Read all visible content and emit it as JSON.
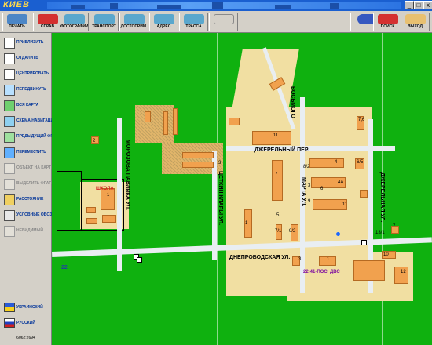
{
  "window": {
    "app_logo": "КИЕВ",
    "controls": [
      "_",
      "□",
      "x"
    ]
  },
  "toolbar": {
    "buttons": [
      {
        "id": "print",
        "label": "ПЕЧАТЬ",
        "color": "#4c86c6"
      },
      {
        "id": "help",
        "label": "СПРАВ",
        "color": "#d43030"
      },
      {
        "id": "photos",
        "label": "ФОТОГРАФИИ",
        "color": "#5aa7cd"
      },
      {
        "id": "transport",
        "label": "ТРАНСПОРТ",
        "color": "#5aa7cd"
      },
      {
        "id": "sights",
        "label": "ДОСТОПРИМ.",
        "color": "#5aa7cd"
      },
      {
        "id": "address",
        "label": "АДРЕС",
        "color": "#5aa7cd"
      },
      {
        "id": "route",
        "label": "ТРАССА",
        "color": "#5aa7cd"
      },
      {
        "id": "edit",
        "label": "",
        "color": "#d4d0c8"
      },
      {
        "id": "back",
        "label": "",
        "color": "#3658c0"
      },
      {
        "id": "search",
        "label": "ПОИСК",
        "color": "#d43030"
      },
      {
        "id": "exit",
        "label": "ВЫХОД",
        "color": "#d4d0c8"
      }
    ]
  },
  "sidebar": {
    "items": [
      {
        "label": "ПРИБЛИЗИТЬ",
        "enabled": true,
        "icon": "zoom-in-icon"
      },
      {
        "label": "ОТДАЛИТЬ",
        "enabled": true,
        "icon": "zoom-out-icon"
      },
      {
        "label": "ЦЕНТРИРОВАТЬ",
        "enabled": true,
        "icon": "center-icon"
      },
      {
        "label": "ПЕРЕДВИНУТЬ",
        "enabled": true,
        "icon": "move-icon"
      },
      {
        "label": "ВСЯ КАРТА",
        "enabled": true,
        "icon": "whole-map-icon"
      },
      {
        "label": "СХЕМА НАВИГАЦИИ",
        "enabled": true,
        "icon": "navigation-icon"
      },
      {
        "label": "ПРЕДЫДУЩИЙ ФРАГМЕНТ",
        "enabled": true,
        "icon": "previous-icon"
      },
      {
        "label": "ПЕРЕМЕСТИТЬ",
        "enabled": true,
        "icon": "relocate-icon"
      },
      {
        "label": "ОБЪЕКТ НА КАРТЕ",
        "enabled": false,
        "icon": "object-icon"
      },
      {
        "label": "ВЫДЕЛИТЬ ФРАГМЕНТ",
        "enabled": false,
        "icon": "select-icon"
      },
      {
        "label": "РАССТОЯНИЕ",
        "enabled": true,
        "icon": "distance-icon"
      },
      {
        "label": "УСЛОВНЫЕ ОБОЗНАЧЕНИЯ",
        "enabled": true,
        "icon": "legend-icon"
      },
      {
        "label": "НЕВИДИМЫЙ",
        "enabled": false,
        "icon": "invisible-icon"
      }
    ],
    "languages": [
      {
        "label": "УКРАИНСКИЙ",
        "icon": "ukraine-flag-icon"
      },
      {
        "label": "РУССКИЙ",
        "icon": "russia-flag-icon"
      }
    ],
    "coordinates": "6062:2694"
  },
  "map": {
    "streets": {
      "dneprovodskaya": "ДНЕПРОВОДСКАЯ УЛ.",
      "dzherelny": "ДЖЕРЕЛЬНЫЙ ПЕР.",
      "dzherelnaya": "ДЖЕРЕЛЬНАЯ УЛ.",
      "marta": "МАРТА УЛ.",
      "vosmogo": "ВОСЬМОГО",
      "klary": "ЦЕТКИН КЛАРЫ УЛ.",
      "morozova": "МОРОЗОВА ПАВЛИКА УЛ."
    },
    "labels": {
      "school": "ШКОЛА",
      "bus_stop": "22;41-ПОС. ДВС",
      "route_number": "22"
    },
    "numbers": [
      "1",
      "2",
      "3",
      "3",
      "1",
      "3",
      "11",
      "7",
      "7",
      "8/2",
      "4",
      "4А",
      "3",
      "6",
      "9",
      "4",
      "6/5",
      "7,6",
      "11",
      "1",
      "13",
      "7/1",
      "9/2",
      "5",
      "7",
      "13/1",
      "10",
      "12",
      "3",
      "2",
      "4",
      "1",
      "8",
      "6"
    ]
  }
}
